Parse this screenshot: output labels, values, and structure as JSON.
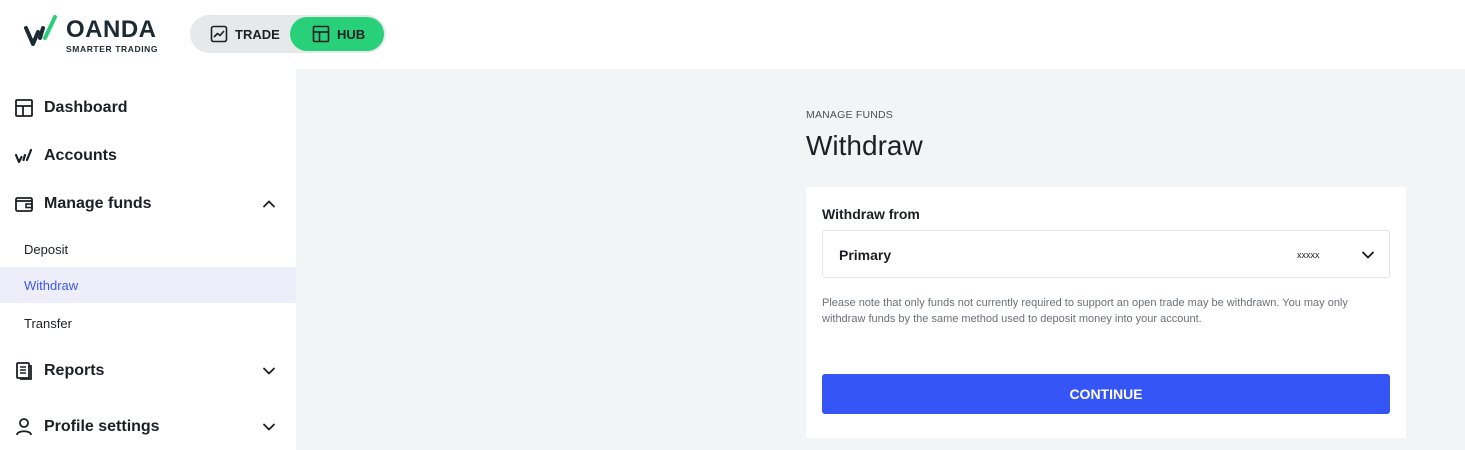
{
  "brand": {
    "name": "OANDA",
    "tagline": "SMARTER TRADING"
  },
  "switcher": {
    "trade_label": "TRADE",
    "hub_label": "HUB",
    "active": "HUB",
    "active_color": "#29d07a"
  },
  "sidebar": {
    "items": [
      {
        "label": "Dashboard",
        "icon": "dashboard-icon"
      },
      {
        "label": "Accounts",
        "icon": "oanda-mark-icon"
      },
      {
        "label": "Manage funds",
        "icon": "wallet-icon",
        "expanded": true,
        "children": [
          {
            "label": "Deposit"
          },
          {
            "label": "Withdraw",
            "active": true
          },
          {
            "label": "Transfer"
          }
        ]
      },
      {
        "label": "Reports",
        "icon": "reports-icon",
        "expanded": false
      },
      {
        "label": "Profile settings",
        "icon": "user-icon",
        "expanded": false
      }
    ]
  },
  "main": {
    "breadcrumb": "MANAGE FUNDS",
    "title": "Withdraw",
    "form": {
      "withdraw_from_label": "Withdraw from",
      "selected_account": "Primary",
      "account_number": "xxxxx",
      "note": "Please note that only funds not currently required to support an open trade may be withdrawn. You may only withdraw funds by the same method used to deposit money into your account.",
      "continue_label": "CONTINUE"
    }
  },
  "colors": {
    "accent": "#3555f7",
    "active_nav_bg": "#edeefa",
    "active_nav_text": "#3b57f5",
    "page_bg": "#f3f4f6",
    "brand_green": "#29d07a"
  }
}
